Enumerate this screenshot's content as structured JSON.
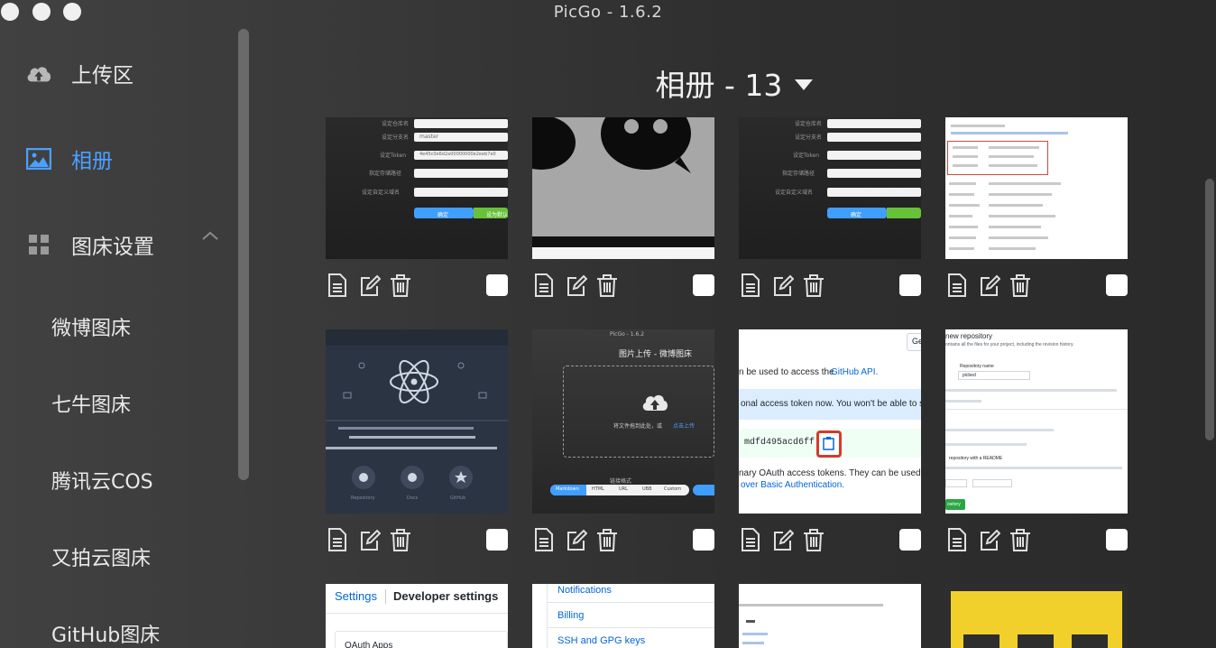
{
  "window": {
    "title": "PicGo - 1.6.2"
  },
  "sidebar": {
    "items": [
      {
        "label": "上传区",
        "icon": "cloud-upload-icon"
      },
      {
        "label": "相册",
        "icon": "image-icon"
      },
      {
        "label": "图床设置",
        "icon": "grid-icon"
      }
    ],
    "sub_items": [
      "微博图床",
      "七牛图床",
      "腾讯云COS",
      "又拍云图床",
      "GitHub图床"
    ]
  },
  "album": {
    "title": "相册 - 13"
  },
  "thumbnails": {
    "t1": {
      "l1": "设定仓库名",
      "l2": "设定分支名",
      "v2": "master",
      "l3": "设定Token",
      "v3": "4e45c0e6d2a00000000e2eeb7e0",
      "l4": "指定存储路径",
      "l5": "设定自定义域名",
      "ok": "确定",
      "def": "设为默认"
    },
    "t3": {
      "ok": "确定"
    },
    "t6": {
      "header": "PicGo - 1.6.2",
      "title": "图片上传 - 微博图床",
      "drop": "将文件拖到此处，或",
      "click": "点击上传",
      "fmt": "链接格式",
      "tabs": [
        "Markdown",
        "HTML",
        "URL",
        "UBB",
        "Custom"
      ]
    },
    "t7": {
      "text1": "n be used to access the",
      "link1": "GitHub API.",
      "text2": "onal access token now. You won't be able to s",
      "token": "mdfd495acd6ff",
      "text3": "nary OAuth access tokens. They can be used instead",
      "link3": "over Basic Authentication.",
      "btn": "Ge"
    },
    "t8": {
      "heading": "new repository",
      "sub": "ontains all the files for your project, including the revision history.",
      "repo_label": "Repository name",
      "repo_value": "picbed",
      "readme": "repository with a README",
      "create": "ository"
    },
    "t9": {
      "tab1": "Settings",
      "tab2": "Developer settings",
      "item": "OAuth Apps"
    },
    "t10": {
      "items": [
        "Notifications",
        "Billing",
        "SSH and GPG keys"
      ]
    },
    "t5": {
      "repo": "Repository",
      "docs": "Docs",
      "github": "GitHub"
    }
  },
  "colors": {
    "accent": "#4aa0ff",
    "primary_btn": "#409eff",
    "success_btn": "#67c23a",
    "github_link": "#0366d6"
  }
}
